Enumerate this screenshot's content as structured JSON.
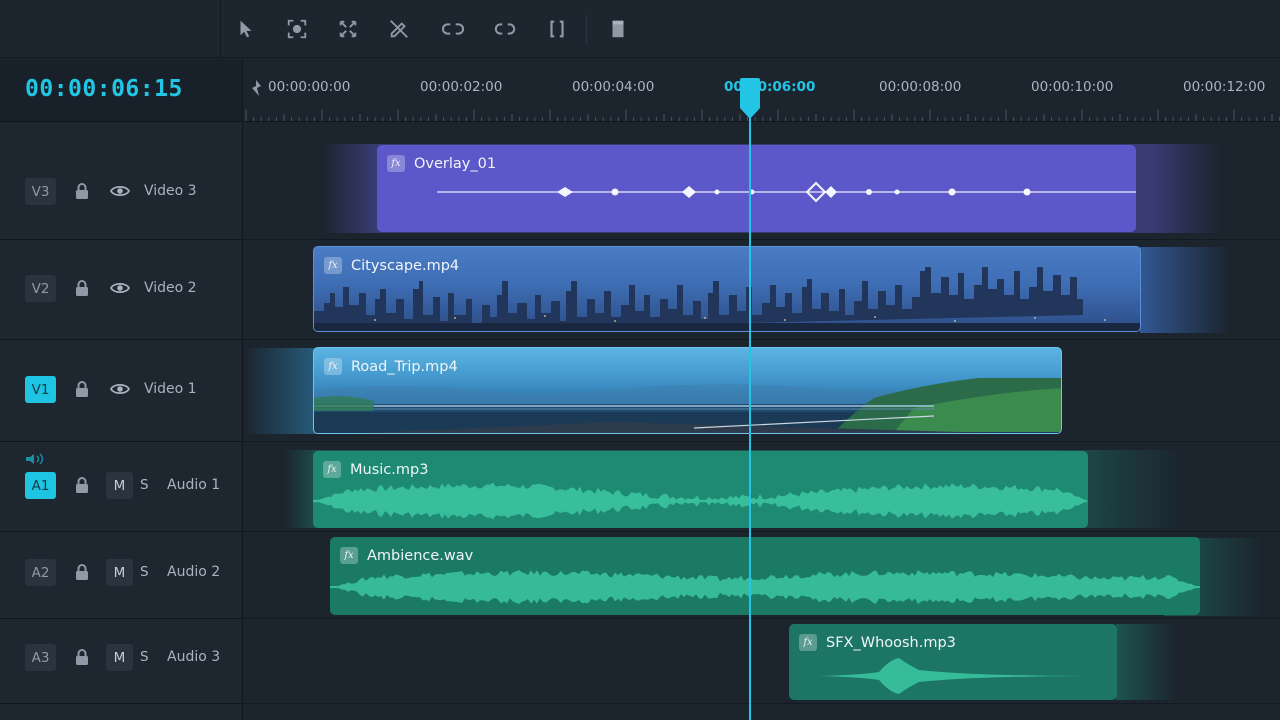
{
  "timecode": "00:00:06:15",
  "toolbar": {
    "tools": [
      "select-tool-icon",
      "focus-tool-icon",
      "expand-tool-icon",
      "razor-tool-icon",
      "link-tool-icon",
      "unlink-tool-icon",
      "bracket-tool-icon",
      "marker-tool-icon"
    ]
  },
  "ruler": {
    "labels": [
      "00:00:00:00",
      "00:00:02:00",
      "00:00:04:00",
      "00:00:06:00",
      "00:00:08:00",
      "00:00:10:00",
      "00:00:12:00"
    ],
    "active_label": "00:00:06:00"
  },
  "tracks": [
    {
      "id": "V3",
      "name": "Video 3",
      "kind": "video",
      "active": false
    },
    {
      "id": "V2",
      "name": "Video 2",
      "kind": "video",
      "active": false
    },
    {
      "id": "V1",
      "name": "Video 1",
      "kind": "video",
      "active": true
    },
    {
      "id": "A1",
      "name": "Audio 1",
      "kind": "audio",
      "active": true,
      "mute_label": "M",
      "solo_label": "S"
    },
    {
      "id": "A2",
      "name": "Audio 2",
      "kind": "audio",
      "active": false,
      "mute_label": "M",
      "solo_label": "S"
    },
    {
      "id": "A3",
      "name": "Audio 3",
      "kind": "audio",
      "active": false,
      "mute_label": "M",
      "solo_label": "S"
    }
  ],
  "clips": [
    {
      "name": "Overlay_01",
      "track": "V3",
      "color": "#5a56c4"
    },
    {
      "name": "Cityscape.mp4",
      "track": "V2",
      "color": "#3f6fb8"
    },
    {
      "name": "Road_Trip.mp4",
      "track": "V1",
      "color": "#3a93c8"
    },
    {
      "name": "Music.mp3",
      "track": "A1",
      "color": "#1f8a74"
    },
    {
      "name": "Ambience.wav",
      "track": "A2",
      "color": "#1c7a68"
    },
    {
      "name": "SFX_Whoosh.mp3",
      "track": "A3",
      "color": "#1d7566"
    }
  ],
  "colors": {
    "accent": "#22c6e4",
    "background": "#1c242e"
  }
}
